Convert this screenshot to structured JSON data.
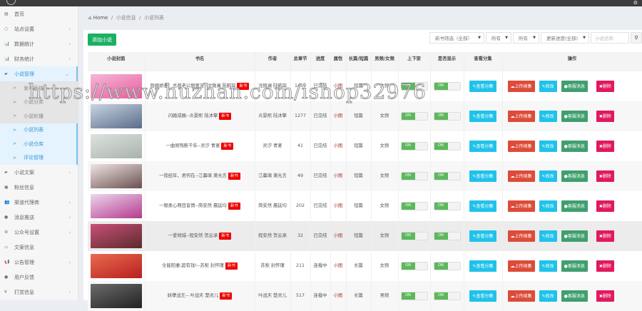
{
  "sidebar": {
    "items": [
      {
        "label": "首页",
        "icon": "▤"
      },
      {
        "label": "站点设置",
        "icon": "○",
        "arrow": "‹"
      },
      {
        "label": "数据统计",
        "icon": "📊",
        "arrow": "‹"
      },
      {
        "label": "财务统计",
        "icon": "📊",
        "arrow": "‹"
      },
      {
        "label": "小说管理",
        "icon": "▰",
        "arrow": "⌄"
      }
    ],
    "sub": [
      {
        "label": "发布区域"
      },
      {
        "label": "小说分类"
      },
      {
        "label": "小说轮播"
      },
      {
        "label": "小说列表"
      },
      {
        "label": "小说仓库"
      },
      {
        "label": "评论管理"
      }
    ],
    "items2": [
      {
        "label": "小说文案",
        "icon": "▰",
        "arrow": "‹"
      },
      {
        "label": "粉丝信息",
        "icon": "▣"
      },
      {
        "label": "渠道代理商",
        "icon": "👥",
        "arrow": "‹"
      },
      {
        "label": "消息推送",
        "icon": "●",
        "arrow": "‹"
      },
      {
        "label": "公众号设置",
        "icon": "⚙",
        "arrow": "‹"
      },
      {
        "label": "文案信息",
        "icon": "▭"
      },
      {
        "label": "公告管理",
        "icon": "📢",
        "arrow": "‹"
      },
      {
        "label": "用户反馈",
        "icon": "●"
      },
      {
        "label": "打赏信息",
        "icon": "¥",
        "arrow": "‹"
      }
    ]
  },
  "breadcrumb": {
    "home": "Home",
    "sep": "/",
    "l1": "小说信息",
    "l2": "小说列表"
  },
  "toolbar": {
    "add": "添加小说",
    "f1": "新书筛选（全部）",
    "f2": "所有",
    "f3": "所有",
    "f4": "更新进度(全部)",
    "search_placeholder": "小说名称"
  },
  "table": {
    "headers": [
      "小说封面",
      "书名",
      "作者",
      "总章节",
      "进度",
      "属性",
      "长篇/短篇",
      "男频/女频",
      "上下架",
      "是否显示",
      "查看分集",
      "操作"
    ],
    "new_badge": "新书",
    "on": "ON",
    "btns": {
      "view": "查看分集",
      "upload": "上传续集",
      "edit": "修改",
      "msg": "客服消息",
      "del": "删除"
    },
    "rows": [
      {
        "name": "隐婚娇妻：总裁老公狠狠宠--沈微澜 陆鹤琛",
        "author": "沈微澜 陆鹤琛",
        "chapters": "1459",
        "progress": "已完结",
        "attr": "小图",
        "length": "短篇",
        "gender": "女频",
        "c1": "#f3b9d4",
        "c2": "#ea5aa0"
      },
      {
        "name": "闪婚成瘾--炎景熙 陆沐擎",
        "author": "炎景熙 陆沐擎",
        "chapters": "1277",
        "progress": "已完结",
        "attr": "小图",
        "length": "短篇",
        "gender": "女频",
        "c1": "#c9d4e4",
        "c2": "#5a6c8a"
      },
      {
        "name": "一曲倾殇断千年--灵汐 青宴",
        "author": "灵汐 青宴",
        "chapters": "41",
        "progress": "已完结",
        "attr": "小图",
        "length": "短篇",
        "gender": "女频",
        "c1": "#dde3df",
        "c2": "#a8b3ad"
      },
      {
        "name": "一揽经年，君何在--江暮璃 萧允言",
        "author": "江暮璃 萧允言",
        "chapters": "49",
        "progress": "已完结",
        "attr": "小图",
        "length": "短篇",
        "gender": "女频",
        "c1": "#efe5e3",
        "c2": "#6a5050"
      },
      {
        "name": "一眼柔心两目盲情--简安然 晨廷均",
        "author": "简安然 晨廷均",
        "chapters": "202",
        "progress": "已完结",
        "attr": "小图",
        "length": "短篇",
        "gender": "女频",
        "c1": "#ecd7ec",
        "c2": "#b43a8e"
      },
      {
        "name": "一爱倾城--程安然 贺云承",
        "author": "程安然 贺云承",
        "chapters": "32",
        "progress": "已完结",
        "attr": "小图",
        "length": "短篇",
        "gender": "女频",
        "c1": "#c9507a",
        "c2": "#5b2b2b"
      },
      {
        "name": "全能阳妻,超有钱!--苏梨 封怀瑾",
        "author": "苏梨 封怀瑾",
        "chapters": "211",
        "progress": "连载中",
        "attr": "小图",
        "length": "长篇",
        "gender": "女频",
        "c1": "#e96b4f",
        "c2": "#b8201f"
      },
      {
        "name": "妖孽战王-- 叶战天 楚灵儿",
        "author": "叶战天 楚灵儿",
        "chapters": "517",
        "progress": "连载中",
        "attr": "小图",
        "length": "长篇",
        "gender": "男频",
        "c1": "#6b6b6b",
        "c2": "#222"
      }
    ]
  },
  "watermark": "https://www.huzhan.com/ishop32976"
}
